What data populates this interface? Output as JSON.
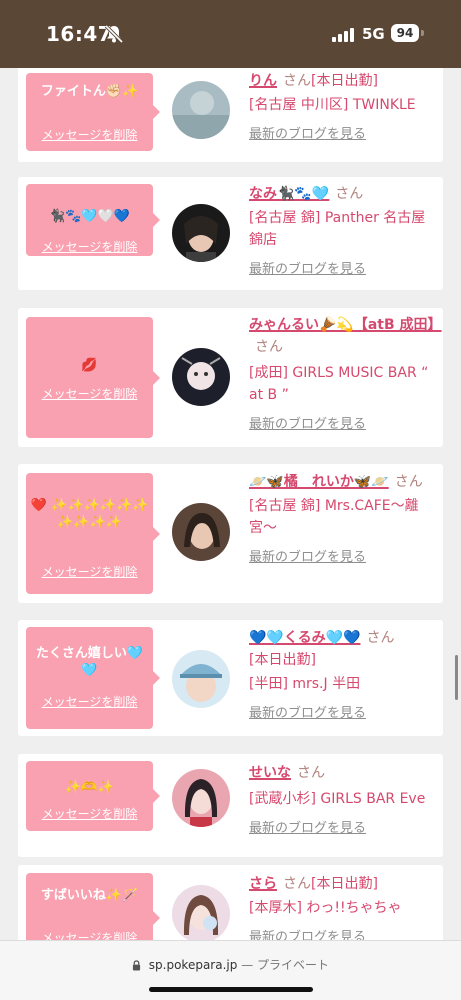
{
  "status_bar": {
    "time": "16:47",
    "network": "5G",
    "battery": "94"
  },
  "common": {
    "delete_label": "メッセージを削除",
    "blog_label": "最新のブログを見る",
    "san": "さん"
  },
  "cards": [
    {
      "message": "ファイトん✊🏻✨",
      "name": "りん",
      "line1": "[本日出勤]",
      "line2": "[名古屋 中川区] TWINKLE"
    },
    {
      "message": "🐈‍⬛🐾🩵🤍💙",
      "name": "なみ🐈‍⬛🐾🩵",
      "line1": "",
      "line2": "[名古屋 錦] Panther 名古屋錦店"
    },
    {
      "message": "💋",
      "name": "みゃんるい🪘💫【atB 成田】",
      "line1": "",
      "line2": "[成田] GIRLS MUSIC BAR “ at B ”"
    },
    {
      "message": "❤️ ✨✨✨✨✨✨ ✨✨✨✨",
      "name": "🪐🦋橘　れいか🦋🪐",
      "line1": "",
      "line2": "[名古屋 錦] Mrs.CAFE〜離宮〜"
    },
    {
      "message": "たくさん嬉しい🩵🩵",
      "name": "💙🩵くるみ🩵💙",
      "line1": "[本日出勤]",
      "line2": "[半田] mrs.J 半田"
    },
    {
      "message": "✨🫶✨",
      "name": "せいな",
      "line1": "",
      "line2": "[武蔵小杉] GIRLS BAR Eve"
    },
    {
      "message": "すばいいね✨🪄",
      "name": "さら",
      "line1": "[本日出勤]",
      "line2": "[本厚木] わっ!!ちゃちゃ"
    }
  ],
  "bottom_bar": {
    "url": "sp.pokepara.jp",
    "separator": "—",
    "private_label": "プライベート"
  }
}
